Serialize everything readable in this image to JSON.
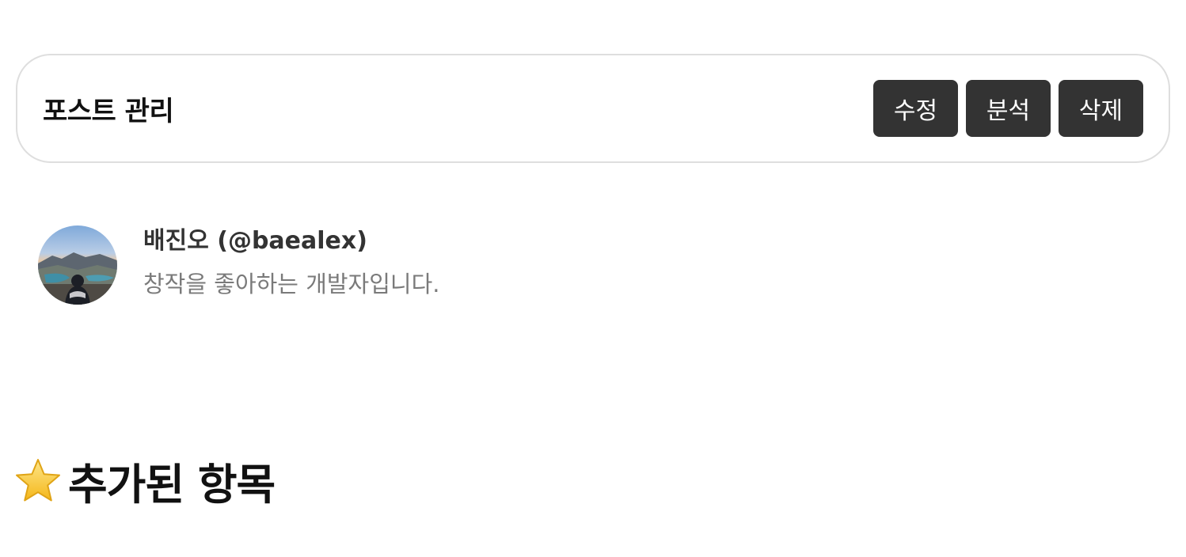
{
  "manage_bar": {
    "title": "포스트 관리",
    "buttons": {
      "edit": "수정",
      "analyze": "분석",
      "delete": "삭제"
    }
  },
  "profile": {
    "name": "배진오 (@baealex)",
    "bio": "창작을 좋아하는 개발자입니다."
  },
  "section": {
    "icon": "star-icon",
    "title": "추가된 항목"
  },
  "colors": {
    "button_bg": "#333333",
    "button_text": "#ffffff",
    "bar_border": "#dedede",
    "bio_text": "#7a7a7a"
  }
}
